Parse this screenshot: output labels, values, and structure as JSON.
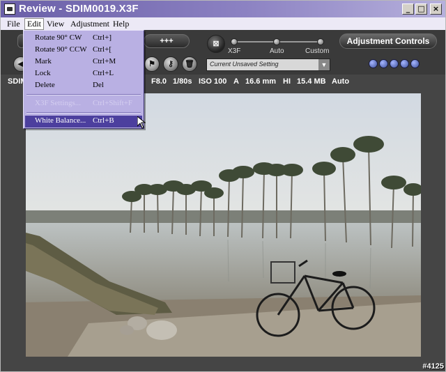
{
  "window": {
    "title": "Review - SDIM0019.X3F",
    "controls": {
      "minimize": "_",
      "maximize": "□",
      "close": "×"
    }
  },
  "menubar": {
    "items": [
      "File",
      "Edit",
      "View",
      "Adjustment",
      "Help"
    ],
    "active": "Edit"
  },
  "edit_menu": {
    "items": [
      {
        "label": "Rotate 90° CW",
        "shortcut": "Ctrl+]",
        "enabled": true
      },
      {
        "label": "Rotate 90° CCW",
        "shortcut": "Ctrl+[",
        "enabled": true
      },
      {
        "label": "Mark",
        "shortcut": "Ctrl+M",
        "enabled": true
      },
      {
        "label": "Lock",
        "shortcut": "Ctrl+L",
        "enabled": true
      },
      {
        "label": "Delete",
        "shortcut": "Del",
        "enabled": true
      },
      {
        "label": "X3F Settings...",
        "shortcut": "Ctrl+Shift+F",
        "enabled": false
      },
      {
        "label": "White Balance...",
        "shortcut": "Ctrl+B",
        "enabled": true,
        "highlighted": true
      }
    ]
  },
  "toolbar": {
    "plus_button": "+++",
    "adjustment_controls_button": "Adjustment Controls",
    "mode_slider": {
      "options": [
        "X3F",
        "Auto",
        "Custom"
      ],
      "selected": "X3F"
    },
    "setting_select": "Current Unsaved Setting",
    "icons": [
      "flag-icon",
      "key-icon",
      "trash-icon",
      "x3f-mode-icon"
    ],
    "led_count": 5,
    "accent_led_color": "#5b6fc8"
  },
  "info": {
    "filename_prefix": "SDIM",
    "aperture": "F8.0",
    "shutter": "1/80s",
    "iso": "ISO 100",
    "mode": "A",
    "focal_length": "16.6 mm",
    "quality": "HI",
    "file_size": "15.4 MB",
    "white_balance": "Auto"
  },
  "watermark": "#4125"
}
